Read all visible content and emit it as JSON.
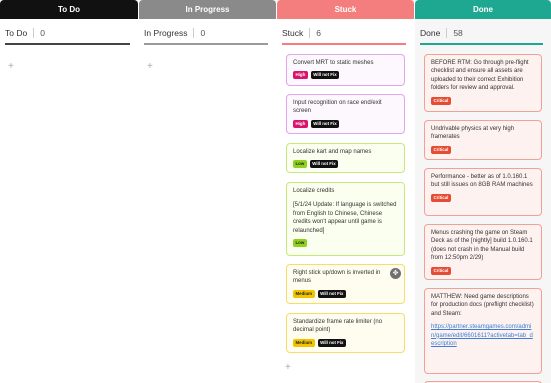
{
  "columns": [
    {
      "header": "To Do",
      "group": {
        "name": "To Do",
        "count": "0"
      },
      "add_label": "+"
    },
    {
      "header": "In Progress",
      "group": {
        "name": "In Progress",
        "count": "0"
      },
      "add_label": "+"
    },
    {
      "header": "Stuck",
      "group": {
        "name": "Stuck",
        "count": "6"
      },
      "add_label": "+",
      "cards": [
        {
          "title": "Convert MRT to static meshes",
          "tags": [
            "High",
            "Will not Fix"
          ]
        },
        {
          "title": "Input recognition on race end/exit screen",
          "tags": [
            "High",
            "Will not Fix"
          ]
        },
        {
          "title": "Localize kart and map names",
          "tags": [
            "Low",
            "Will not Fix"
          ]
        },
        {
          "title": "Localize credits",
          "note": "[5/1/24 Update: If language is switched from English to Chinese, Chinese credits won't appear until game is relaunched]",
          "tags": [
            "Low"
          ]
        },
        {
          "title": "Right stick up/down is inverted in menus",
          "tags": [
            "Medium",
            "Will not Fix"
          ]
        },
        {
          "title": "Standardize frame rate limiter (no decimal point)",
          "tags": [
            "Medium",
            "Will not Fix"
          ]
        }
      ]
    },
    {
      "header": "Done",
      "group": {
        "name": "Done",
        "count": "58"
      },
      "cards": [
        {
          "title": "BEFORE RTM: Go through pre-flight checklist and ensure all assets are uploaded to their correct Exhibition folders for review and approval.",
          "tags": [
            "Critical"
          ]
        },
        {
          "title": "Undrivable physics at very high framerates",
          "tags": [
            "Critical"
          ]
        },
        {
          "title": "Performance - better as of 1.0.160.1 but still issues on 8GB RAM machines",
          "tags": [
            "Critical"
          ]
        },
        {
          "title": "Menus crashing the game on Steam Deck as of the [nightly] build 1.0.160.1 (does not crash in the Manual build from 12:50pm 2/29)",
          "tags": [
            "Critical"
          ]
        },
        {
          "title": "MATTHEW: Need game descriptions for production docs (preflight checklist) and Steam:",
          "link": "https://partner.steamgames.com/admin/game/edit/6601611?activetab=tab_description",
          "tags": []
        }
      ]
    }
  ],
  "icons": {
    "drag_handle": "drag-handle-icon",
    "add": "plus-icon"
  },
  "colors": {
    "todo": "#111111",
    "in_progress": "#8a8a8a",
    "stuck": "#f47d7d",
    "done": "#1ea891",
    "high": "#d9146b",
    "low": "#8fd11f",
    "medium": "#f2c400",
    "will_not_fix": "#111111",
    "critical": "#e54c34"
  }
}
